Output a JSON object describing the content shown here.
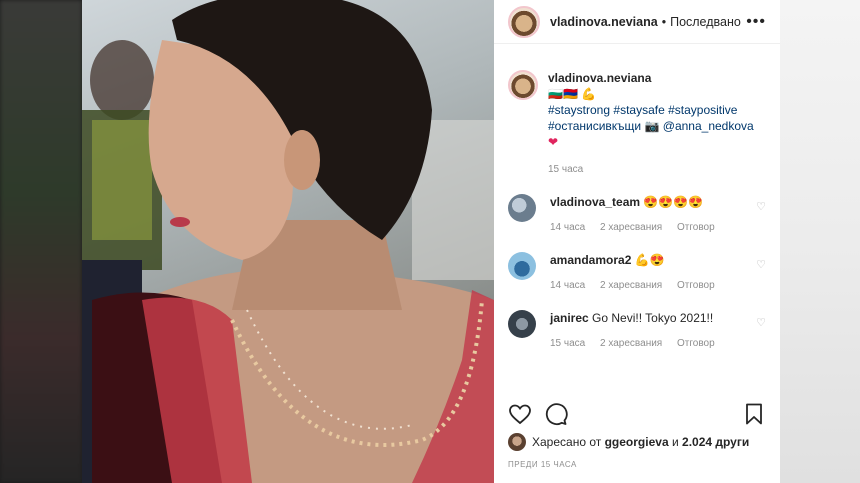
{
  "post": {
    "username": "vladinova.neviana",
    "separator": "•",
    "follow_label": "Последвано",
    "more_label": "•••"
  },
  "caption": {
    "username": "vladinova.neviana",
    "line1": "🇧🇬🇦🇲 💪",
    "tags1": [
      "#staystrong",
      "#staysafe",
      "#staypositive"
    ],
    "tag2": "#останисивкъщи",
    "camera": "📷",
    "mention": "@anna_nedkova",
    "heart": "❤",
    "time": "15 часа"
  },
  "comments": [
    {
      "username": "vladinova_team",
      "text": "😍😍😍😍",
      "time": "14 часа",
      "likes": "2 харесвания",
      "reply": "Отговор",
      "avatar_color": "#8aa0b4"
    },
    {
      "username": "amandamora2",
      "text": "💪😍",
      "time": "14 часа",
      "likes": "2 харесвания",
      "reply": "Отговор",
      "avatar_color": "#6fa3c6"
    },
    {
      "username": "janirec",
      "text": "Go Nevi!! Tokyo 2021!!",
      "time": "15 часа",
      "likes": "2 харесвания",
      "reply": "Отговор",
      "avatar_color": "#4d5866"
    }
  ],
  "likes": {
    "prefix": "Харесано от",
    "user": "ggeorgieva",
    "conj": "и",
    "count": "2.024 други"
  },
  "timeago": "ПРЕДИ 15 ЧАСА",
  "icons": [
    "heart-icon",
    "comment-icon",
    "bookmark-icon",
    "more-icon"
  ]
}
